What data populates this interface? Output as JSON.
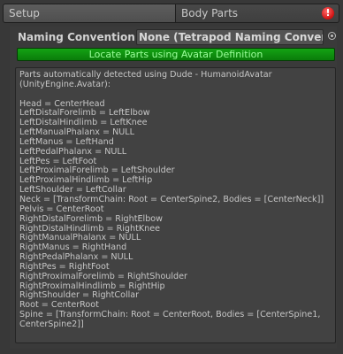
{
  "tabs": [
    {
      "label": "Setup"
    },
    {
      "label": "Body Parts",
      "error_icon": "!"
    }
  ],
  "naming": {
    "label": "Naming Convention",
    "value": "None (Tetrapod Naming Convention)"
  },
  "locate_button": "Locate Parts using Avatar Definition",
  "colors": {
    "background": "#383838",
    "locate_button": "#0f8f0f",
    "locate_button_text": "#9cff9c",
    "error": "#d01010"
  },
  "icons": [
    "error-icon",
    "gear-icon"
  ],
  "log_lines": [
    "Parts automatically detected using Dude - HumanoidAvatar",
    "(UnityEngine.Avatar):",
    "",
    "Head = CenterHead",
    "LeftDistalForelimb = LeftElbow",
    "LeftDistalHindlimb = LeftKnee",
    "LeftManualPhalanx = NULL",
    "LeftManus = LeftHand",
    "LeftPedalPhalanx = NULL",
    "LeftPes = LeftFoot",
    "LeftProximalForelimb = LeftShoulder",
    "LeftProximalHindlimb = LeftHip",
    "LeftShoulder = LeftCollar",
    "Neck = [TransformChain: Root = CenterSpine2, Bodies = [CenterNeck]]",
    "Pelvis = CenterRoot",
    "RightDistalForelimb = RightElbow",
    "RightDistalHindlimb = RightKnee",
    "RightManualPhalanx = NULL",
    "RightManus = RightHand",
    "RightPedalPhalanx = NULL",
    "RightPes = RightFoot",
    "RightProximalForelimb = RightShoulder",
    "RightProximalHindlimb = RightHip",
    "RightShoulder = RightCollar",
    "Root = CenterRoot",
    "Spine = [TransformChain: Root = CenterRoot, Bodies = [CenterSpine1,",
    "CenterSpine2]]"
  ]
}
